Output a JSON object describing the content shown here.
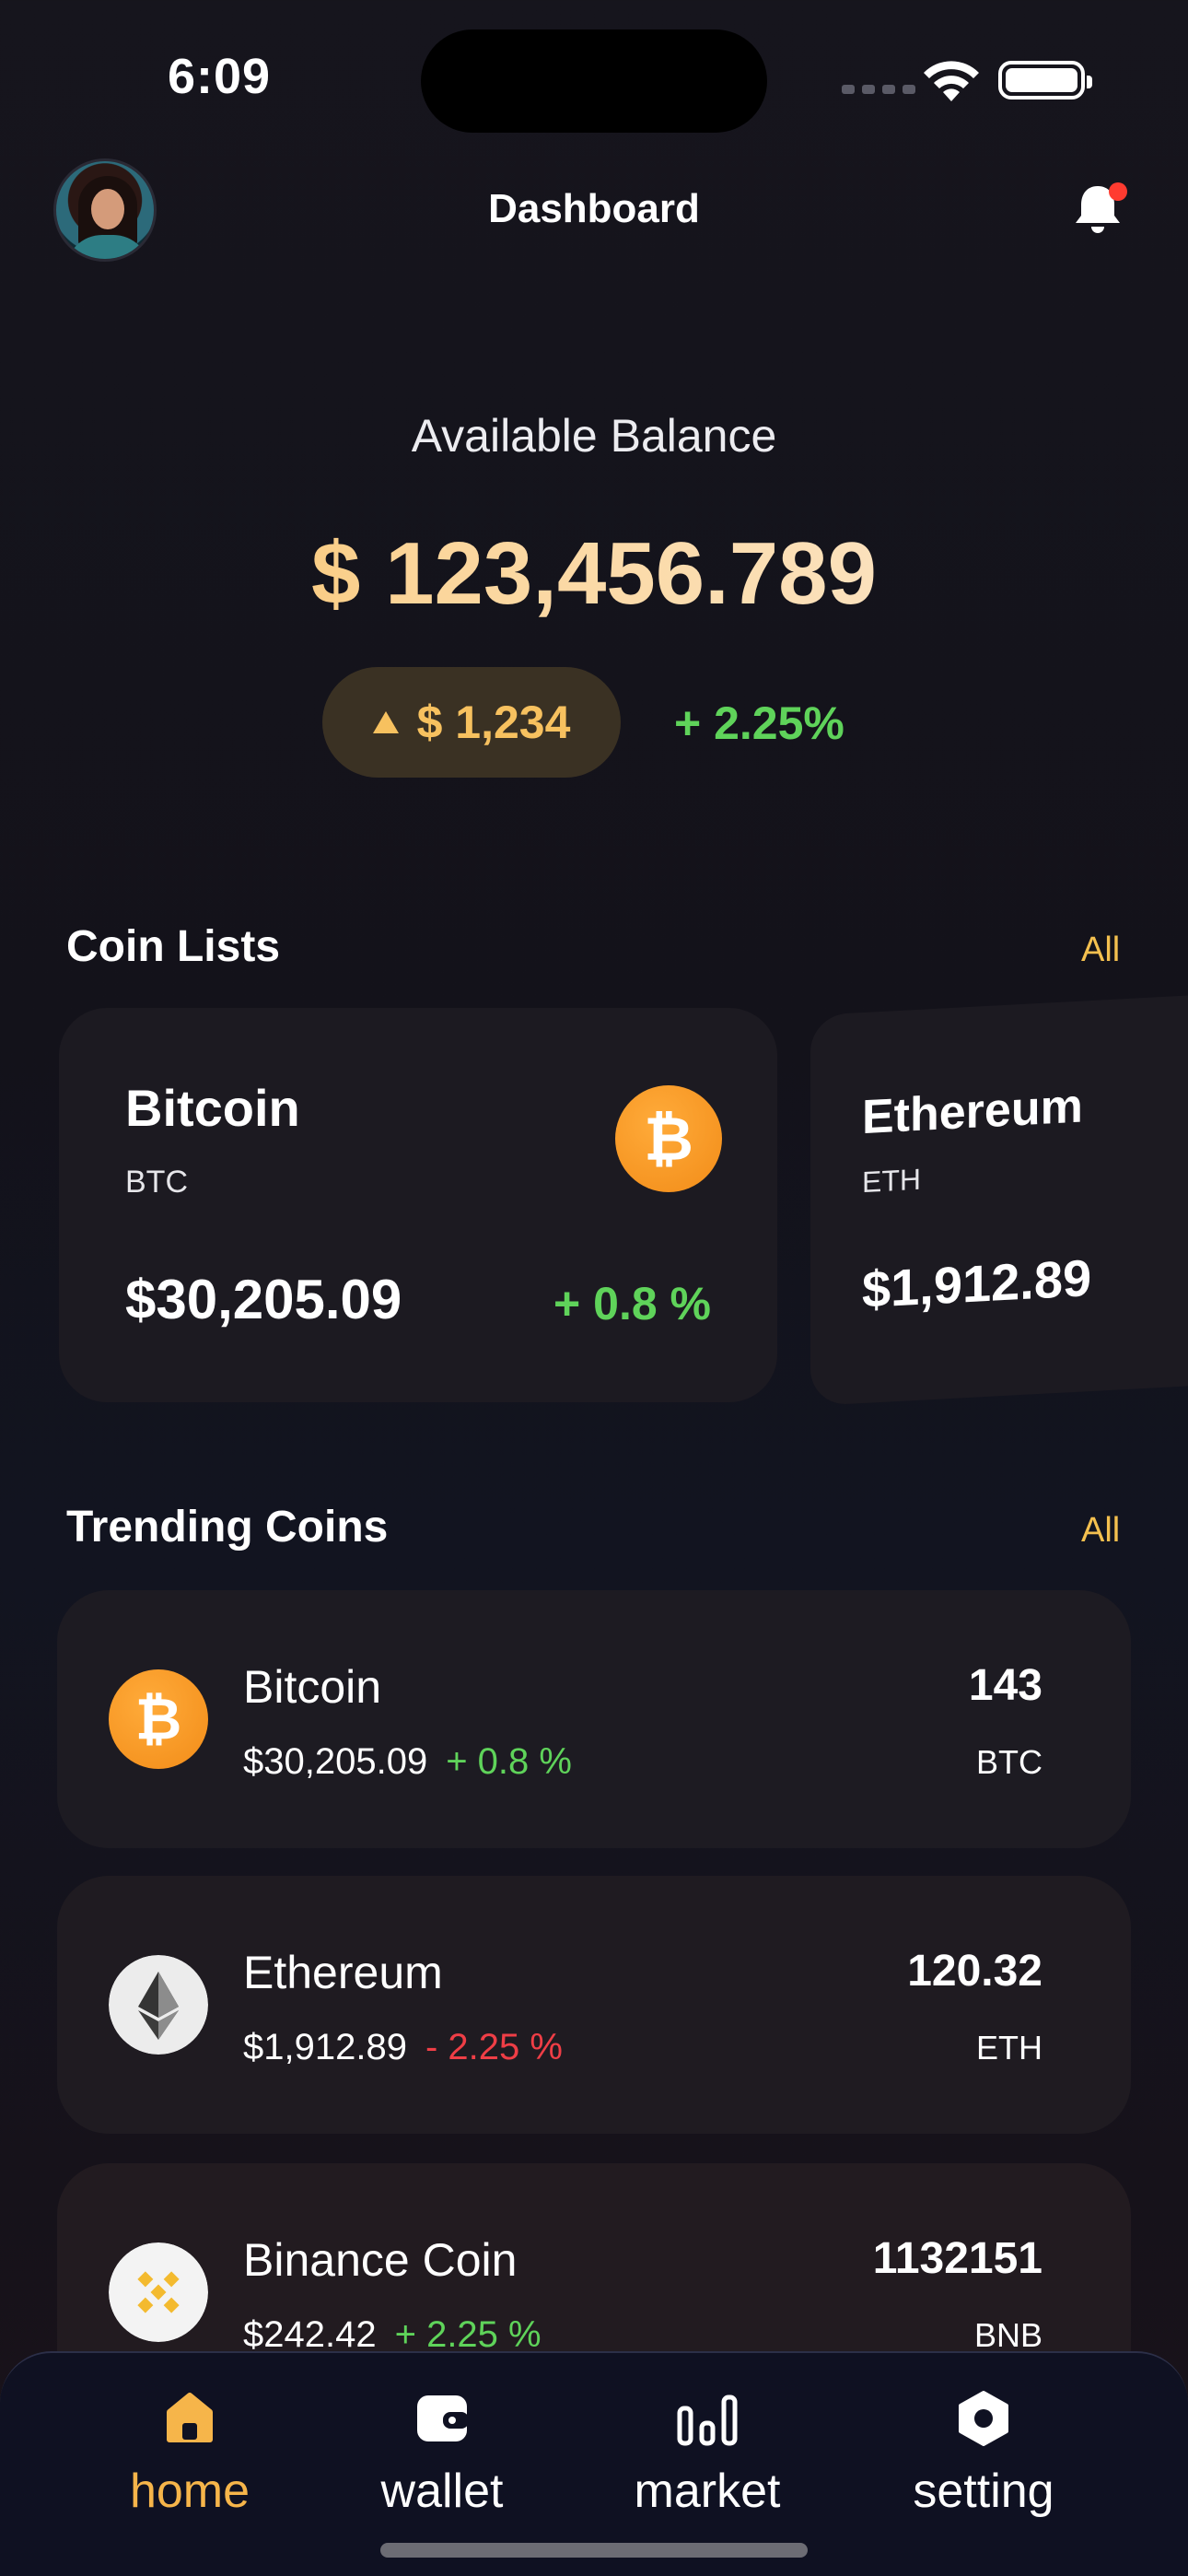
{
  "status_bar": {
    "time": "6:09"
  },
  "header": {
    "title": "Dashboard"
  },
  "balance": {
    "label": "Available Balance",
    "value": "$ 123,456.789",
    "change_amount": "$ 1,234",
    "change_percent": "+ 2.25%"
  },
  "coin_lists": {
    "title": "Coin Lists",
    "see_all": "All",
    "cards": [
      {
        "name": "Bitcoin",
        "symbol": "BTC",
        "price": "$30,205.09",
        "change": "+ 0.8 %",
        "icon": "bitcoin-icon"
      },
      {
        "name": "Ethereum",
        "symbol": "ETH",
        "price": "$1,912.89",
        "icon": "ethereum-icon"
      }
    ]
  },
  "trending": {
    "title": "Trending Coins",
    "see_all": "All",
    "items": [
      {
        "name": "Bitcoin",
        "price": "$30,205.09",
        "change": "+ 0.8 %",
        "amount": "143",
        "symbol": "BTC",
        "icon": "bitcoin-icon"
      },
      {
        "name": "Ethereum",
        "price": "$1,912.89",
        "change": "- 2.25 %",
        "amount": "120.32",
        "symbol": "ETH",
        "icon": "ethereum-icon"
      },
      {
        "name": "Binance Coin",
        "price": "$242.42",
        "change": "+ 2.25 %",
        "amount": "1132151",
        "symbol": "BNB",
        "icon": "binance-icon"
      }
    ]
  },
  "nav": {
    "items": [
      {
        "label": "home",
        "icon": "home-icon",
        "active": true
      },
      {
        "label": "wallet",
        "icon": "wallet-icon",
        "active": false
      },
      {
        "label": "market",
        "icon": "market-icon",
        "active": false
      },
      {
        "label": "setting",
        "icon": "settings-icon",
        "active": false
      }
    ]
  },
  "colors": {
    "accent": "#f6b54a",
    "positive": "#5fd35a",
    "negative": "#ef3e46",
    "background": "#14131b",
    "card": "#1c1a21"
  }
}
